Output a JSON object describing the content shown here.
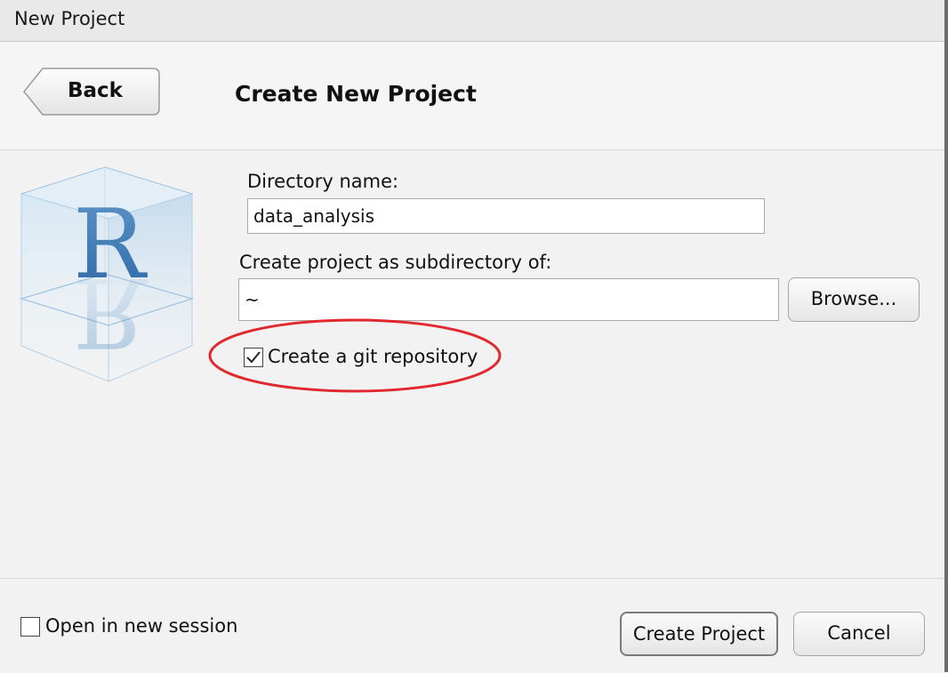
{
  "window": {
    "title": "New Project"
  },
  "header": {
    "back_label": "Back",
    "heading": "Create New Project"
  },
  "form": {
    "directory_label": "Directory name:",
    "directory_value": "data_analysis",
    "subdir_label": "Create project as subdirectory of:",
    "subdir_value": "~",
    "browse_label": "Browse...",
    "git_label": "Create a git repository",
    "git_checked": true
  },
  "footer": {
    "new_session_label": "Open in new session",
    "new_session_checked": false,
    "create_label": "Create Project",
    "cancel_label": "Cancel"
  },
  "logo": {
    "letter": "R"
  },
  "annotation": {
    "highlight_color": "#e0282e"
  }
}
